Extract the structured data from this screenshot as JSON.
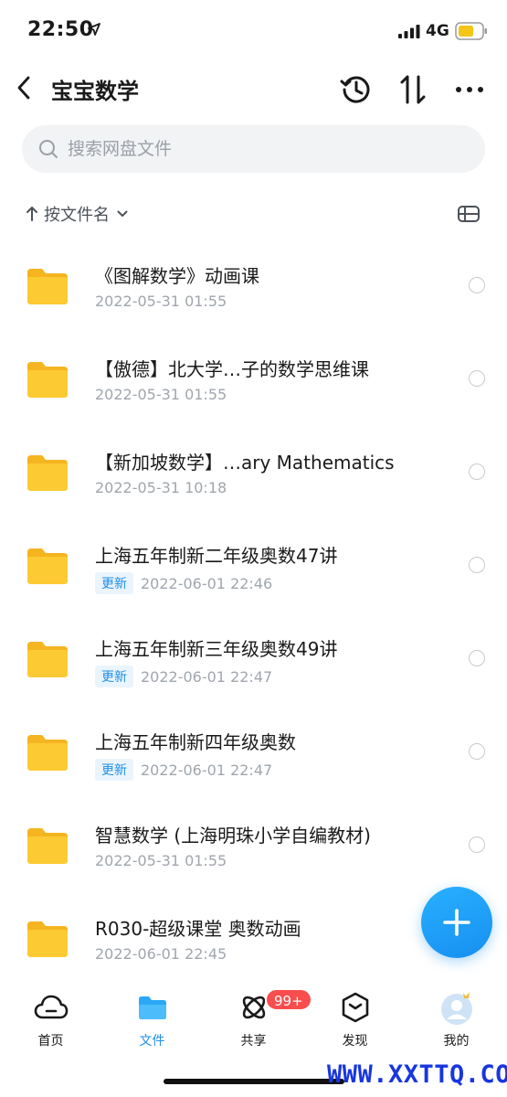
{
  "status_bar": {
    "time": "22:50",
    "network": "4G"
  },
  "header": {
    "title": "宝宝数学"
  },
  "search": {
    "placeholder": "搜索网盘文件"
  },
  "sort": {
    "label": "按文件名"
  },
  "files": [
    {
      "name": "《图解数学》动画课",
      "date": "2022-05-31 01:55",
      "badge": ""
    },
    {
      "name": "【傲德】北大学…子的数学思维课",
      "date": "2022-05-31 01:55",
      "badge": ""
    },
    {
      "name": "【新加坡数学】…ary Mathematics",
      "date": "2022-05-31 10:18",
      "badge": ""
    },
    {
      "name": "上海五年制新二年级奥数47讲",
      "date": "2022-06-01 22:46",
      "badge": "更新"
    },
    {
      "name": "上海五年制新三年级奥数49讲",
      "date": "2022-06-01 22:47",
      "badge": "更新"
    },
    {
      "name": "上海五年制新四年级奥数",
      "date": "2022-06-01 22:47",
      "badge": "更新"
    },
    {
      "name": "智慧数学 (上海明珠小学自编教材)",
      "date": "2022-05-31 01:55",
      "badge": ""
    },
    {
      "name": "R030-超级课堂 奥数动画",
      "date": "2022-06-01 22:45",
      "badge": ""
    }
  ],
  "tabs": [
    {
      "label": "首页",
      "icon": "cloud-icon",
      "active": false
    },
    {
      "label": "文件",
      "icon": "folder-icon",
      "active": true
    },
    {
      "label": "共享",
      "icon": "atom-icon",
      "active": false
    },
    {
      "label": "发现",
      "icon": "cube-icon",
      "active": false
    },
    {
      "label": "我的",
      "icon": "avatar-icon",
      "active": false
    }
  ],
  "share_badge": "99+",
  "watermark": "WWW.XXTTQ.COM",
  "colors": {
    "accent": "#1f8fe8",
    "folder": "#fcc82f",
    "badge_red": "#fa4d4d"
  }
}
